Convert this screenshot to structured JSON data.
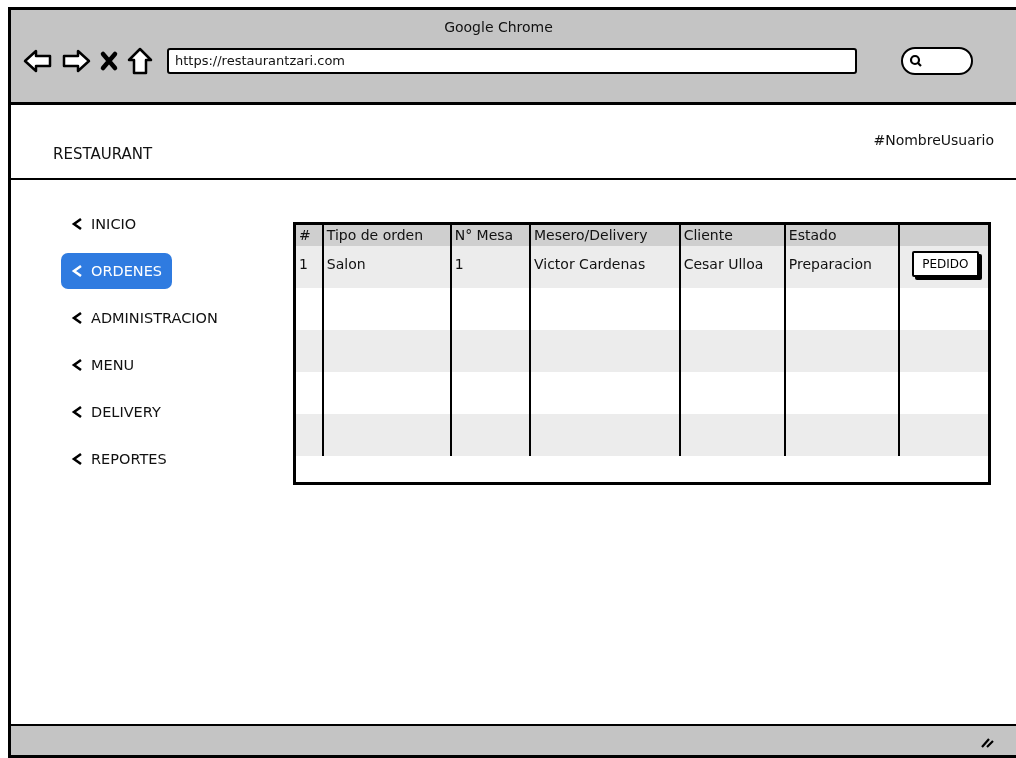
{
  "window": {
    "title": "Google Chrome"
  },
  "browser": {
    "url": "https://restaurantzari.com"
  },
  "header": {
    "brand": "RESTAURANT",
    "user": "#NombreUsuario"
  },
  "sidebar": {
    "items": [
      {
        "label": "INICIO",
        "selected": false
      },
      {
        "label": "ORDENES",
        "selected": true
      },
      {
        "label": "ADMINISTRACION",
        "selected": false
      },
      {
        "label": "MENU",
        "selected": false
      },
      {
        "label": "DELIVERY",
        "selected": false
      },
      {
        "label": "REPORTES",
        "selected": false
      }
    ]
  },
  "table": {
    "columns": [
      "#",
      "Tipo de orden",
      "N° Mesa",
      "Mesero/Delivery",
      "Cliente",
      "Estado"
    ],
    "rows": [
      {
        "cells": [
          "1",
          "Salon",
          "1",
          "Victor Cardenas",
          "Cesar Ulloa",
          "Preparacion"
        ],
        "action": "PEDIDO"
      }
    ]
  }
}
